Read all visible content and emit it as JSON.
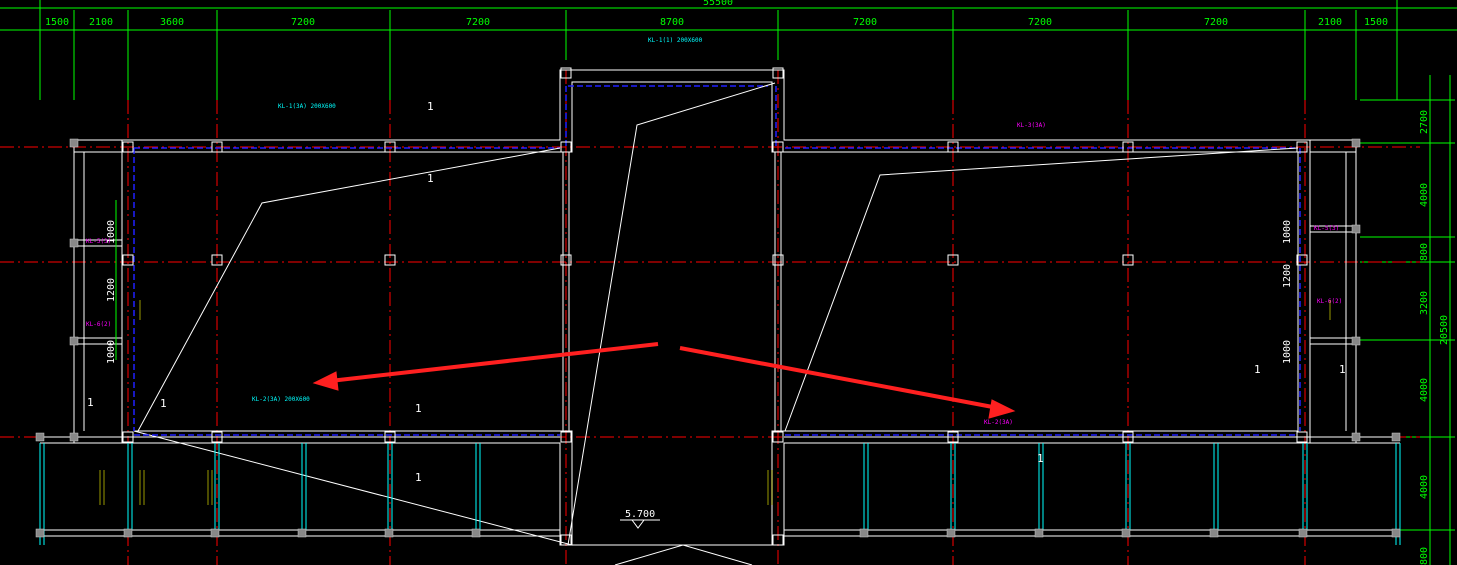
{
  "drawing": {
    "top_total_dimension": "55500",
    "top_dimensions": [
      "1500",
      "2100",
      "3600",
      "7200",
      "7200",
      "8700",
      "7200",
      "7200",
      "7200",
      "2100",
      "1500"
    ],
    "right_dimensions": [
      "2700",
      "4000",
      "800",
      "3200",
      "4000",
      "4000",
      "800"
    ],
    "right_total_dimension": "20500",
    "left_dimensions": [
      "1000",
      "1200",
      "1000"
    ],
    "right_inner_dimensions": [
      "1000",
      "1200",
      "1000"
    ],
    "elevation_label": "5.700",
    "slab_numbers": [
      "1",
      "1",
      "1",
      "1",
      "1",
      "1",
      "1",
      "1",
      "1"
    ]
  },
  "annotations": {
    "beam_tags": [
      {
        "text": "KL-1(1) 200X600",
        "color": "#00ffff"
      },
      {
        "text": "KL-1(3A) 200X600",
        "color": "#00ffff"
      },
      {
        "text": "KL-2(3A) 200X600",
        "color": "#00ffff"
      },
      {
        "text": "KL-3(3A)",
        "color": "#ff00ff"
      },
      {
        "text": "KL-2(3A)",
        "color": "#ff00ff"
      },
      {
        "text": "KL-5(3)",
        "color": "#ff00ff"
      },
      {
        "text": "KL-5(3)",
        "color": "#ff00ff"
      },
      {
        "text": "KL-6(2)",
        "color": "#ff00ff"
      },
      {
        "text": "KL-6(2)",
        "color": "#ff00ff"
      }
    ]
  },
  "colors": {
    "background": "#000000",
    "dimension": "#00ff00",
    "axis": "#ff0000",
    "beam_outline": "#ffffff",
    "beam_inner": "#00ffff",
    "slab_edge": "#0000ff",
    "yellow_text": "#ffff00",
    "magenta_text": "#ff00ff",
    "cyan_text": "#00ffff",
    "arrow": "#ff2020"
  }
}
